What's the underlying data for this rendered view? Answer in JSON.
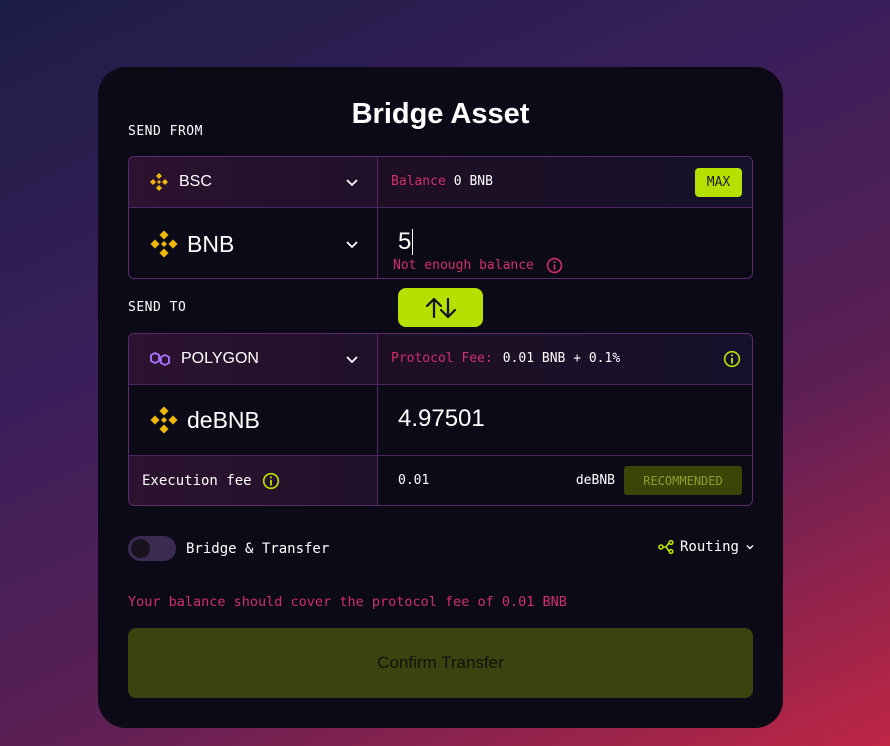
{
  "title": "Bridge Asset",
  "send_from": {
    "label": "SEND FROM",
    "chain": "BSC",
    "balance_label": "Balance",
    "balance_value": "0 BNB",
    "max_label": "MAX",
    "token": "BNB",
    "amount": "5",
    "error": "Not enough balance"
  },
  "swap_icon": "swap-arrows-icon",
  "send_to": {
    "label": "SEND TO",
    "chain": "POLYGON",
    "fee_label": "Protocol Fee:",
    "fee_value": "0.01 BNB + 0.1%",
    "token": "deBNB",
    "amount": "4.97501",
    "exec_fee_label": "Execution fee",
    "exec_fee_value": "0.01",
    "exec_fee_unit": "deBNB",
    "recommended_label": "RECOMMENDED"
  },
  "options": {
    "bridge_transfer_label": "Bridge & Transfer",
    "bridge_transfer_on": false,
    "routing_label": "Routing"
  },
  "warning": "Your balance should cover the protocol fee of 0.01 BNB",
  "confirm_label": "Confirm Transfer",
  "colors": {
    "accent": "#b6e100",
    "error": "#d02f6a",
    "card_bg": "#0d0a17"
  }
}
